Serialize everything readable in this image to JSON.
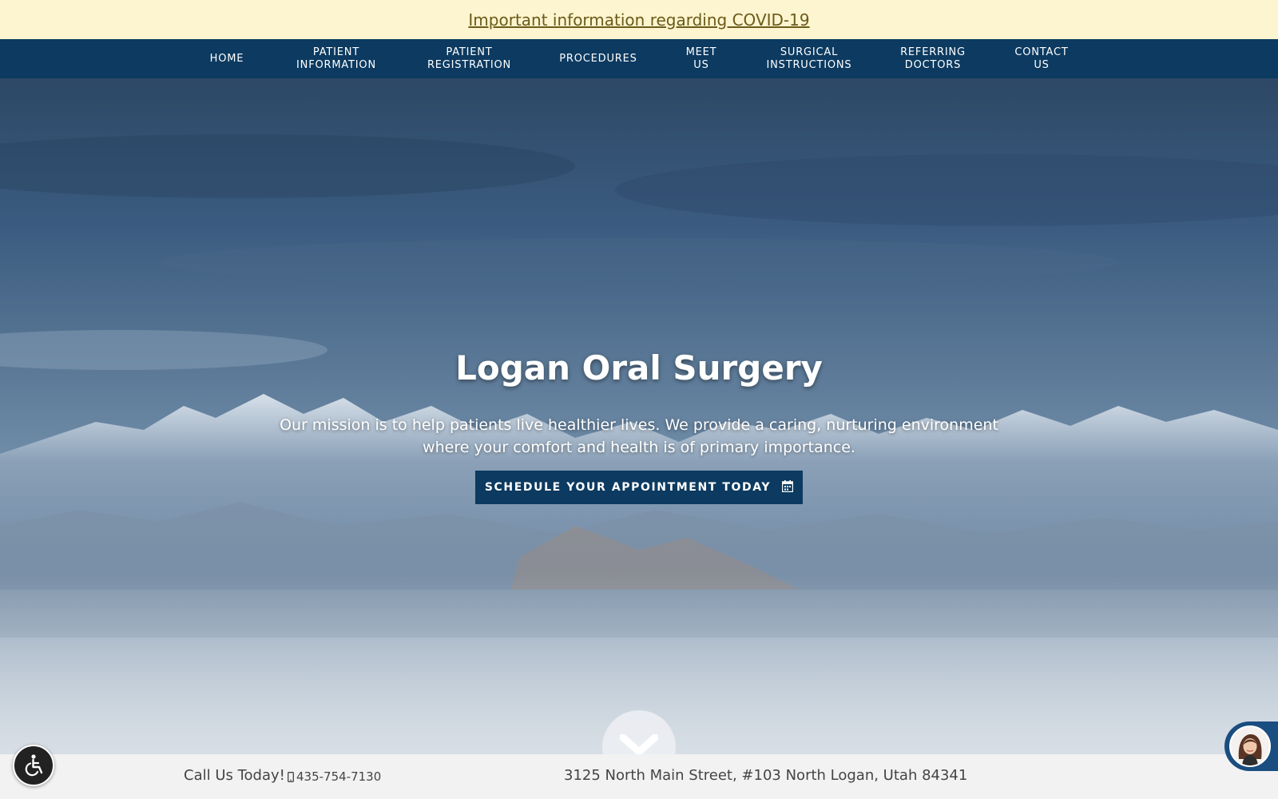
{
  "announcement": {
    "covid_link": "Important information regarding COVID-19"
  },
  "nav": {
    "items": [
      {
        "label": "HOME"
      },
      {
        "label": "PATIENT\nINFORMATION"
      },
      {
        "label": "PATIENT\nREGISTRATION"
      },
      {
        "label": "PROCEDURES"
      },
      {
        "label": "MEET\nUS"
      },
      {
        "label": "SURGICAL\nINSTRUCTIONS"
      },
      {
        "label": "REFERRING\nDOCTORS"
      },
      {
        "label": "CONTACT\nUS"
      }
    ]
  },
  "hero": {
    "title": "Logan Oral Surgery",
    "mission": "Our mission is to help patients live healthier lives. We provide a caring, nurturing environment where your comfort and health is of primary importance.",
    "cta_label": "SCHEDULE YOUR APPOINTMENT TODAY",
    "cta_icon": "calendar-icon",
    "scroll_icon": "chevron-down-icon"
  },
  "footer": {
    "call_label": "Call Us Today!",
    "phone": "435-754-7130",
    "phone_icon": "mobile-phone-icon",
    "address": "3125 North Main Street, #103 North Logan, Utah 84341"
  },
  "widgets": {
    "accessibility_icon": "wheelchair-icon",
    "chat_icon": "chat-agent-avatar-icon"
  },
  "colors": {
    "announcement_bg": "#fdf5cf",
    "announcement_text": "#6b5a1a",
    "nav_bg": "#0c3a60",
    "button_bg": "#0c3a60",
    "footer_bg": "#f2f2f2"
  }
}
